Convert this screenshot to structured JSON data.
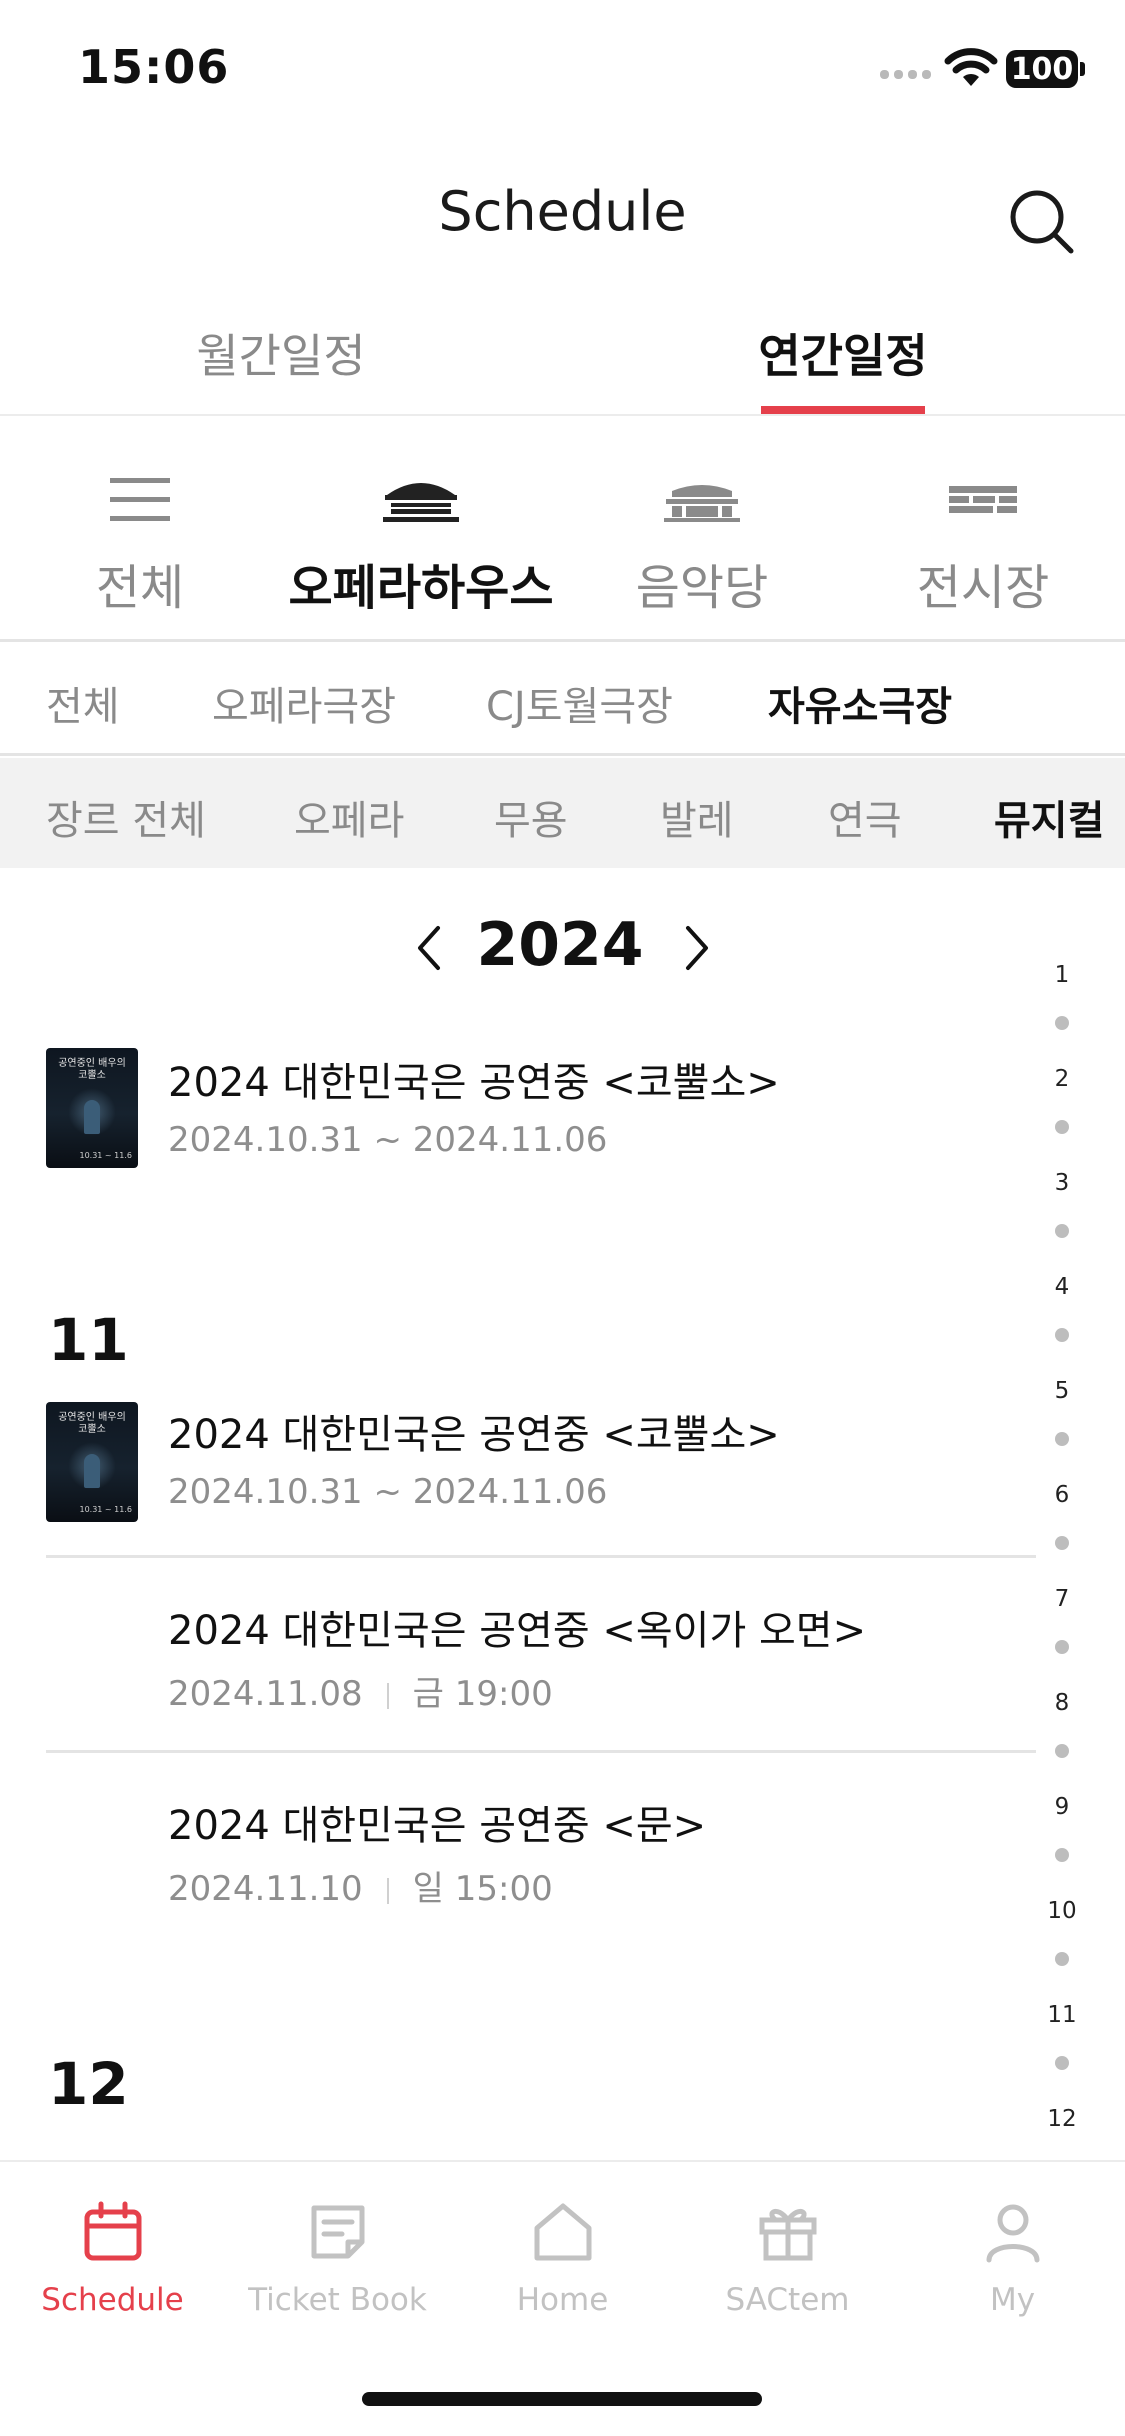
{
  "status_bar": {
    "time": "15:06",
    "battery": "100"
  },
  "header": {
    "title": "Schedule"
  },
  "top_tabs": {
    "monthly": "월간일정",
    "yearly": "연간일정"
  },
  "venues": [
    {
      "label": "전체",
      "icon": "list-icon"
    },
    {
      "label": "오페라하우스",
      "icon": "opera-house-icon"
    },
    {
      "label": "음악당",
      "icon": "concert-hall-icon"
    },
    {
      "label": "전시장",
      "icon": "exhibition-hall-icon"
    }
  ],
  "halls": [
    "전체",
    "오페라극장",
    "CJ토월극장",
    "자유소극장"
  ],
  "genres": [
    "장르 전체",
    "오페라",
    "무용",
    "발레",
    "연극",
    "뮤지컬"
  ],
  "year": "2024",
  "poster_text": {
    "top": "공연중인 배우의\n코뿔소",
    "bottom": "10.31 ~ 11.6"
  },
  "events": [
    {
      "title": "2024 대한민국은 공연중 <코뿔소>",
      "date": "2024.10.31 ~ 2024.11.06"
    },
    {
      "title": "2024 대한민국은 공연중 <코뿔소>",
      "date": "2024.10.31 ~ 2024.11.06"
    },
    {
      "title": "2024 대한민국은 공연중 <옥이가 오면>",
      "date": "2024.11.08",
      "time": "금 19:00"
    },
    {
      "title": "2024 대한민국은 공연중 <문>",
      "date": "2024.11.10",
      "time": "일 15:00"
    }
  ],
  "month_headers": [
    "11",
    "12"
  ],
  "month_index": [
    "1",
    "2",
    "3",
    "4",
    "5",
    "6",
    "7",
    "8",
    "9",
    "10",
    "11",
    "12"
  ],
  "bottom_nav": [
    {
      "label": "Schedule",
      "icon": "calendar-icon"
    },
    {
      "label": "Ticket Book",
      "icon": "ticket-book-icon"
    },
    {
      "label": "Home",
      "icon": "home-icon"
    },
    {
      "label": "SACtem",
      "icon": "gift-icon"
    },
    {
      "label": "My",
      "icon": "user-icon"
    }
  ],
  "colors": {
    "accent": "#e5404b",
    "inactive": "#8a8a8a",
    "text": "#111111",
    "filter_bg": "#f2f2f2"
  }
}
